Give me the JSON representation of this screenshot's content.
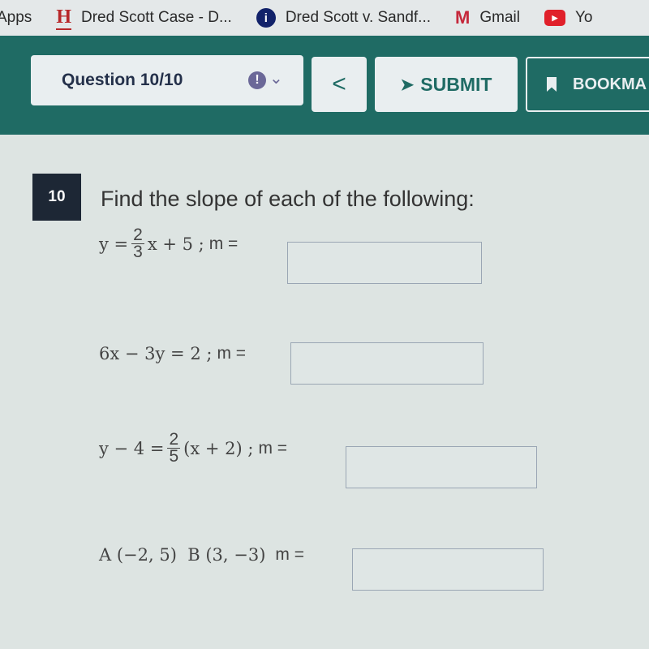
{
  "bookmarks": [
    {
      "label": "Apps",
      "icon": "apps-icon"
    },
    {
      "label": "Dred Scott Case - D...",
      "icon": "history-h-icon",
      "glyph": "H",
      "color": "#b8282a"
    },
    {
      "label": "Dred Scott v. Sandf...",
      "icon": "info-icon",
      "glyph": "i",
      "color": "#12226a"
    },
    {
      "label": "Gmail",
      "icon": "gmail-icon",
      "glyph": "M",
      "color": "#c5283b"
    },
    {
      "label": "Yo",
      "icon": "youtube-icon",
      "glyph": "▶",
      "color": "#e0202a"
    }
  ],
  "toolbar": {
    "question_label": "Question 10/10",
    "alert_glyph": "!",
    "prev_glyph": "<",
    "submit_label": "SUBMIT",
    "bookmark_label": "BOOKMA"
  },
  "colors": {
    "header": "#1f6b64",
    "alert": "#6b6898",
    "badge": "#1d2735"
  },
  "question": {
    "number": "10",
    "prompt": "Find the slope of each of the following:",
    "items": [
      {
        "pre": "y =",
        "num": "2",
        "den": "3",
        "post": "x + 5 ;",
        "m": "m =",
        "value": ""
      },
      {
        "pre": "6x − 3y = 2 ;",
        "m": "m =",
        "value": ""
      },
      {
        "pre": "y − 4 =",
        "num": "2",
        "den": "5",
        "post": "(x + 2) ;",
        "m": "m =",
        "value": ""
      },
      {
        "pre": "A (−2, 5)  B (3, −3)",
        "m": "m =",
        "value": ""
      }
    ]
  }
}
